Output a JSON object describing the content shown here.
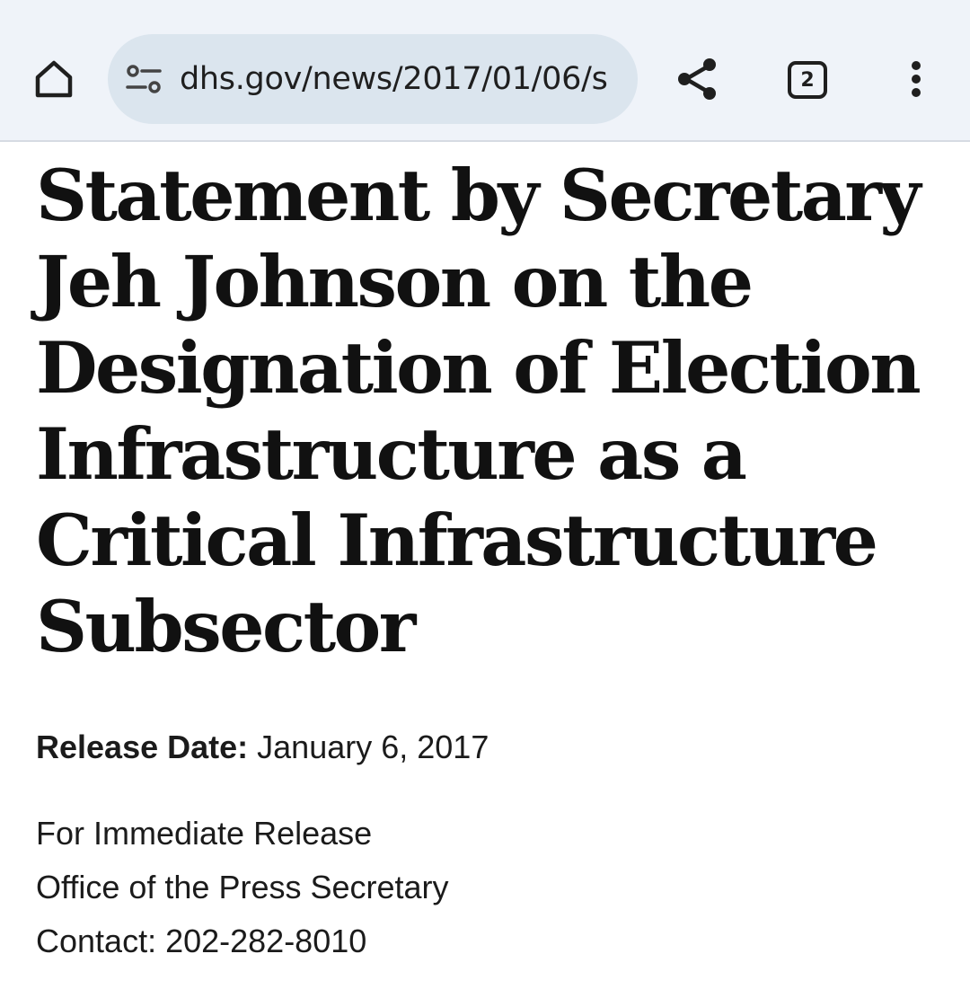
{
  "browser": {
    "url_text": "dhs.gov/news/2017/01/06/s",
    "tab_count": "2",
    "icons": [
      "home-icon",
      "site-settings-icon",
      "share-icon",
      "tab-switcher-icon",
      "more-vert-icon"
    ]
  },
  "article": {
    "headline_lines": [
      "Statement by Secretary",
      "Jeh Johnson on the",
      "Designation of Election",
      "Infrastructure as a",
      "Critical Infrastructure",
      "Subsector"
    ],
    "release_label": "Release Date:",
    "release_date": "January 6, 2017",
    "release_type": "For Immediate Release",
    "office": "Office of the Press Secretary",
    "contact": "Contact: 202-282-8010"
  }
}
